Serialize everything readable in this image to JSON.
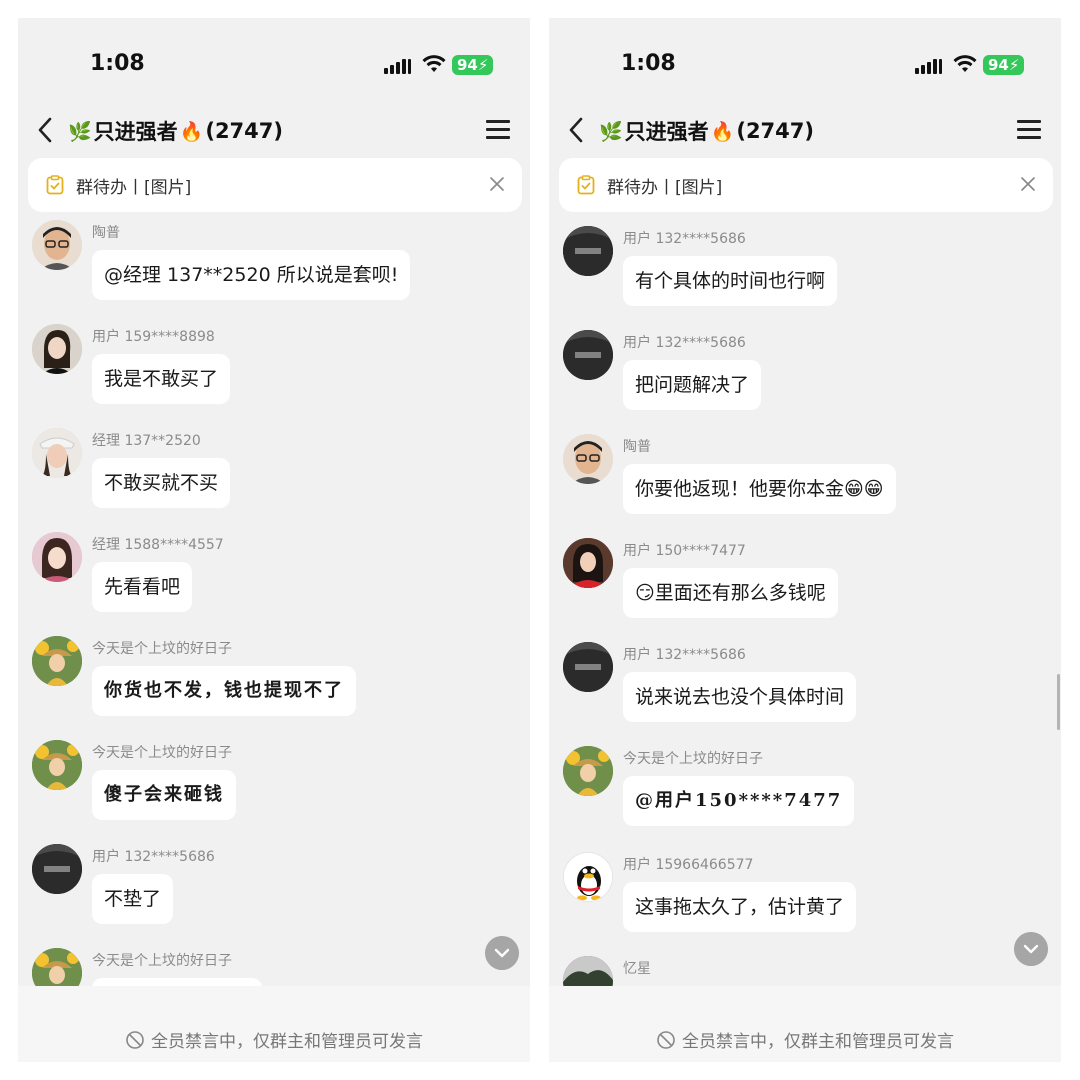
{
  "left": {
    "status": {
      "time": "1:08",
      "battery": "94"
    },
    "header": {
      "title": "只进强者",
      "count": "(2747)",
      "leaf_emoji": "🌿",
      "fire_emoji": "🔥"
    },
    "todo": {
      "text": "群待办丨[图片]"
    },
    "messages": [
      {
        "sender": "陶普",
        "text": "@经理 137**2520 所以说是套呗!",
        "avatar": "taopu"
      },
      {
        "sender": "用户 159****8898",
        "text": "我是不敢买了",
        "avatar": "girl1"
      },
      {
        "sender": "经理 137**2520",
        "text": "不敢买就不买",
        "avatar": "girl2"
      },
      {
        "sender": "经理 1588****4557",
        "text": "先看看吧",
        "avatar": "girl3"
      },
      {
        "sender": "今天是个上坟的好日子",
        "text": "你货也不发，钱也提现不了",
        "avatar": "sun"
      },
      {
        "sender": "今天是个上坟的好日子",
        "text": "傻子会来砸钱",
        "avatar": "sun"
      },
      {
        "sender": "用户 132****5686",
        "text": "不垫了",
        "avatar": "dark"
      },
      {
        "sender": "今天是个上坟的好日子",
        "text": "",
        "avatar": "sun"
      }
    ],
    "notice": "全员禁言中，仅群主和管理员可发言"
  },
  "right": {
    "status": {
      "time": "1:08",
      "battery": "94"
    },
    "header": {
      "title": "只进强者",
      "count": "(2747)",
      "leaf_emoji": "🌿",
      "fire_emoji": "🔥"
    },
    "todo": {
      "text": "群待办丨[图片]"
    },
    "messages": [
      {
        "sender": "用户 132****5686",
        "text": "有个具体的时间也行啊",
        "avatar": "dark"
      },
      {
        "sender": "用户 132****5686",
        "text": "把问题解决了",
        "avatar": "dark"
      },
      {
        "sender": "陶普",
        "text": "你要他返现！他要你本金😁😁",
        "avatar": "taopu"
      },
      {
        "sender": "用户 150****7477",
        "text": "😏里面还有那么多钱呢",
        "avatar": "red"
      },
      {
        "sender": "用户 132****5686",
        "text": "说来说去也没个具体时间",
        "avatar": "dark"
      },
      {
        "sender": "今天是个上坟的好日子",
        "text": "@用户150****7477",
        "avatar": "sun"
      },
      {
        "sender": "用户 15966466577",
        "text": "这事拖太久了，估计黄了",
        "avatar": "qq"
      },
      {
        "sender": "忆星",
        "text": "",
        "avatar": "yixing"
      }
    ],
    "notice": "全员禁言中，仅群主和管理员可发言"
  },
  "icons": {
    "back": "chevron-left-icon",
    "menu": "hamburger-menu-icon",
    "todo": "clipboard-check-icon",
    "close": "close-icon",
    "scroll": "chevron-down-icon",
    "muted": "no-speak-icon",
    "signal": "cellular-signal-icon",
    "wifi": "wifi-icon",
    "battery": "battery-icon"
  },
  "colors": {
    "background": "#f1f1f1",
    "bubble": "#ffffff",
    "battery": "#34c759",
    "sender": "#8b8b8b"
  }
}
